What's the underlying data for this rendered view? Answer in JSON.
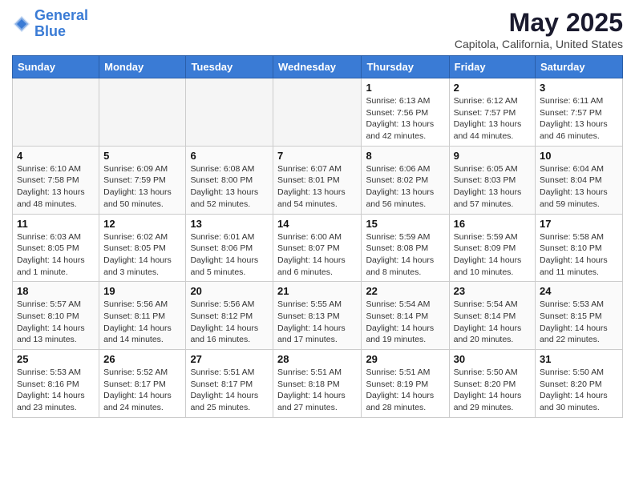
{
  "logo": {
    "line1": "General",
    "line2": "Blue"
  },
  "title": "May 2025",
  "subtitle": "Capitola, California, United States",
  "weekdays": [
    "Sunday",
    "Monday",
    "Tuesday",
    "Wednesday",
    "Thursday",
    "Friday",
    "Saturday"
  ],
  "weeks": [
    [
      {
        "day": "",
        "info": ""
      },
      {
        "day": "",
        "info": ""
      },
      {
        "day": "",
        "info": ""
      },
      {
        "day": "",
        "info": ""
      },
      {
        "day": "1",
        "info": "Sunrise: 6:13 AM\nSunset: 7:56 PM\nDaylight: 13 hours\nand 42 minutes."
      },
      {
        "day": "2",
        "info": "Sunrise: 6:12 AM\nSunset: 7:57 PM\nDaylight: 13 hours\nand 44 minutes."
      },
      {
        "day": "3",
        "info": "Sunrise: 6:11 AM\nSunset: 7:57 PM\nDaylight: 13 hours\nand 46 minutes."
      }
    ],
    [
      {
        "day": "4",
        "info": "Sunrise: 6:10 AM\nSunset: 7:58 PM\nDaylight: 13 hours\nand 48 minutes."
      },
      {
        "day": "5",
        "info": "Sunrise: 6:09 AM\nSunset: 7:59 PM\nDaylight: 13 hours\nand 50 minutes."
      },
      {
        "day": "6",
        "info": "Sunrise: 6:08 AM\nSunset: 8:00 PM\nDaylight: 13 hours\nand 52 minutes."
      },
      {
        "day": "7",
        "info": "Sunrise: 6:07 AM\nSunset: 8:01 PM\nDaylight: 13 hours\nand 54 minutes."
      },
      {
        "day": "8",
        "info": "Sunrise: 6:06 AM\nSunset: 8:02 PM\nDaylight: 13 hours\nand 56 minutes."
      },
      {
        "day": "9",
        "info": "Sunrise: 6:05 AM\nSunset: 8:03 PM\nDaylight: 13 hours\nand 57 minutes."
      },
      {
        "day": "10",
        "info": "Sunrise: 6:04 AM\nSunset: 8:04 PM\nDaylight: 13 hours\nand 59 minutes."
      }
    ],
    [
      {
        "day": "11",
        "info": "Sunrise: 6:03 AM\nSunset: 8:05 PM\nDaylight: 14 hours\nand 1 minute."
      },
      {
        "day": "12",
        "info": "Sunrise: 6:02 AM\nSunset: 8:05 PM\nDaylight: 14 hours\nand 3 minutes."
      },
      {
        "day": "13",
        "info": "Sunrise: 6:01 AM\nSunset: 8:06 PM\nDaylight: 14 hours\nand 5 minutes."
      },
      {
        "day": "14",
        "info": "Sunrise: 6:00 AM\nSunset: 8:07 PM\nDaylight: 14 hours\nand 6 minutes."
      },
      {
        "day": "15",
        "info": "Sunrise: 5:59 AM\nSunset: 8:08 PM\nDaylight: 14 hours\nand 8 minutes."
      },
      {
        "day": "16",
        "info": "Sunrise: 5:59 AM\nSunset: 8:09 PM\nDaylight: 14 hours\nand 10 minutes."
      },
      {
        "day": "17",
        "info": "Sunrise: 5:58 AM\nSunset: 8:10 PM\nDaylight: 14 hours\nand 11 minutes."
      }
    ],
    [
      {
        "day": "18",
        "info": "Sunrise: 5:57 AM\nSunset: 8:10 PM\nDaylight: 14 hours\nand 13 minutes."
      },
      {
        "day": "19",
        "info": "Sunrise: 5:56 AM\nSunset: 8:11 PM\nDaylight: 14 hours\nand 14 minutes."
      },
      {
        "day": "20",
        "info": "Sunrise: 5:56 AM\nSunset: 8:12 PM\nDaylight: 14 hours\nand 16 minutes."
      },
      {
        "day": "21",
        "info": "Sunrise: 5:55 AM\nSunset: 8:13 PM\nDaylight: 14 hours\nand 17 minutes."
      },
      {
        "day": "22",
        "info": "Sunrise: 5:54 AM\nSunset: 8:14 PM\nDaylight: 14 hours\nand 19 minutes."
      },
      {
        "day": "23",
        "info": "Sunrise: 5:54 AM\nSunset: 8:14 PM\nDaylight: 14 hours\nand 20 minutes."
      },
      {
        "day": "24",
        "info": "Sunrise: 5:53 AM\nSunset: 8:15 PM\nDaylight: 14 hours\nand 22 minutes."
      }
    ],
    [
      {
        "day": "25",
        "info": "Sunrise: 5:53 AM\nSunset: 8:16 PM\nDaylight: 14 hours\nand 23 minutes."
      },
      {
        "day": "26",
        "info": "Sunrise: 5:52 AM\nSunset: 8:17 PM\nDaylight: 14 hours\nand 24 minutes."
      },
      {
        "day": "27",
        "info": "Sunrise: 5:51 AM\nSunset: 8:17 PM\nDaylight: 14 hours\nand 25 minutes."
      },
      {
        "day": "28",
        "info": "Sunrise: 5:51 AM\nSunset: 8:18 PM\nDaylight: 14 hours\nand 27 minutes."
      },
      {
        "day": "29",
        "info": "Sunrise: 5:51 AM\nSunset: 8:19 PM\nDaylight: 14 hours\nand 28 minutes."
      },
      {
        "day": "30",
        "info": "Sunrise: 5:50 AM\nSunset: 8:20 PM\nDaylight: 14 hours\nand 29 minutes."
      },
      {
        "day": "31",
        "info": "Sunrise: 5:50 AM\nSunset: 8:20 PM\nDaylight: 14 hours\nand 30 minutes."
      }
    ]
  ]
}
